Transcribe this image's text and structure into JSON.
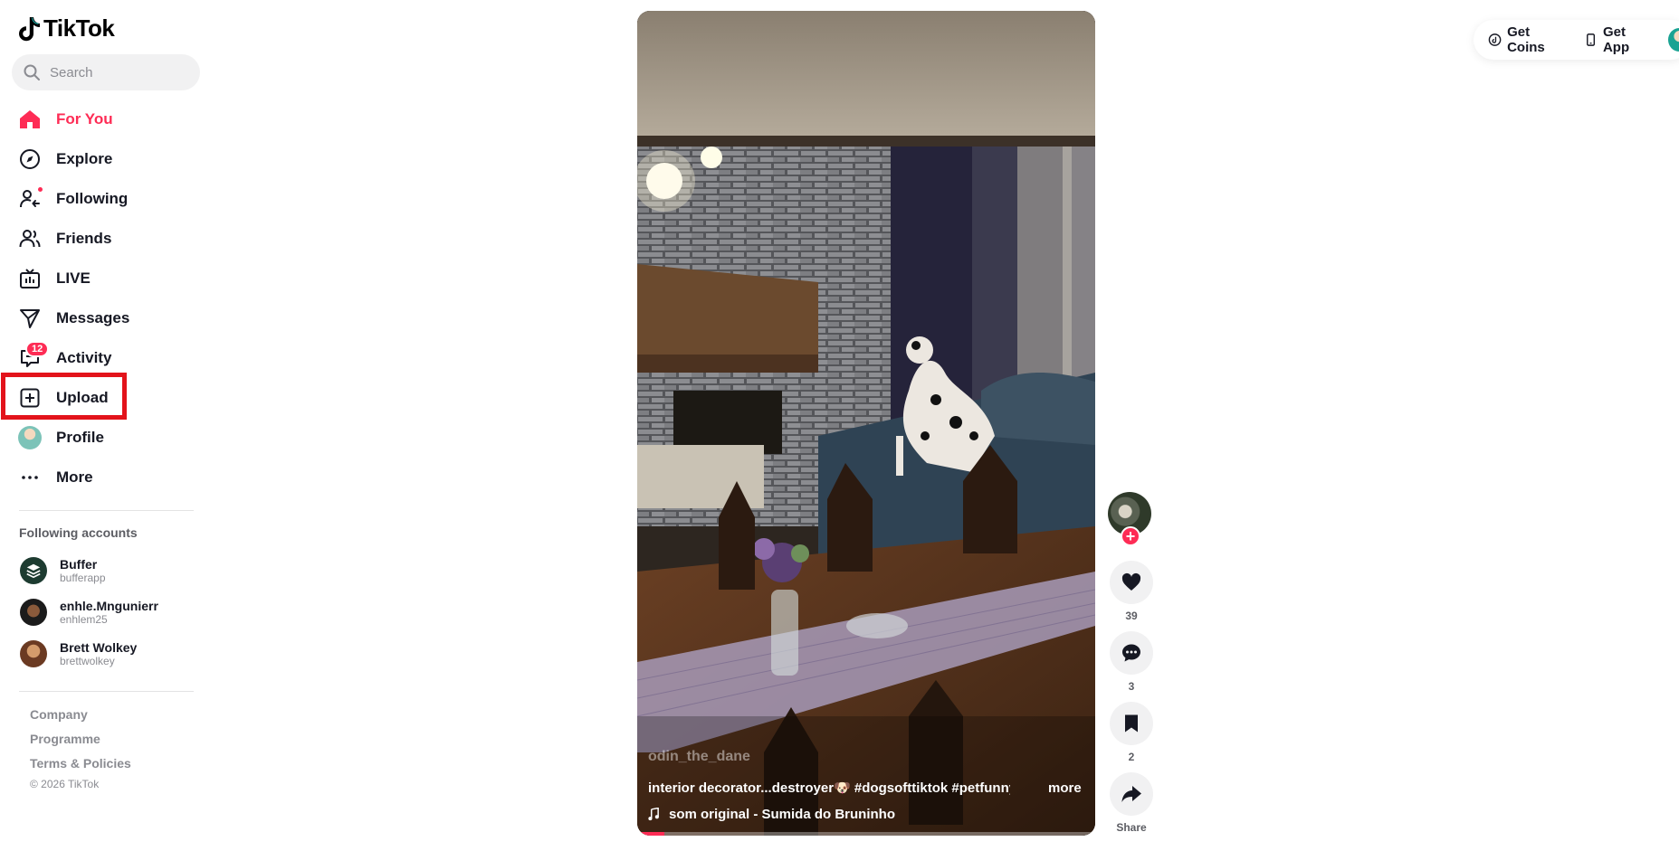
{
  "brand": {
    "name": "TikTok"
  },
  "search": {
    "placeholder": "Search"
  },
  "nav": [
    {
      "label": "For You",
      "icon": "home-icon",
      "active": true
    },
    {
      "label": "Explore",
      "icon": "compass-icon"
    },
    {
      "label": "Following",
      "icon": "following-icon"
    },
    {
      "label": "Friends",
      "icon": "friends-icon"
    },
    {
      "label": "LIVE",
      "icon": "live-icon"
    },
    {
      "label": "Messages",
      "icon": "send-icon"
    },
    {
      "label": "Activity",
      "icon": "activity-icon",
      "badge": "12"
    },
    {
      "label": "Upload",
      "icon": "upload-icon"
    },
    {
      "label": "Profile",
      "icon": "avatar"
    },
    {
      "label": "More",
      "icon": "more-icon"
    }
  ],
  "following": {
    "title": "Following accounts",
    "accounts": [
      {
        "name": "Buffer",
        "username": "bufferapp"
      },
      {
        "name": "enhle.Mngunierr",
        "username": "enhlem25"
      },
      {
        "name": "Brett Wolkey",
        "username": "brettwolkey"
      }
    ]
  },
  "footer": {
    "links": [
      "Company",
      "Programme",
      "Terms & Policies"
    ],
    "copyright": "© 2026 TikTok"
  },
  "topbar": {
    "get_coins": "Get Coins",
    "get_app": "Get App"
  },
  "video": {
    "author": "odin_the_dane",
    "caption": "interior decorator...destroyer🐶 #dogsofttiktok #petfunnys ...",
    "more": "more",
    "music": "som original - Sumida do Bruninho",
    "progress": 0.06
  },
  "actions": {
    "likes": "39",
    "comments": "3",
    "saves": "2",
    "share": "Share"
  },
  "colors": {
    "accent": "#fe2c55",
    "highlight_box": "#e3131b"
  }
}
